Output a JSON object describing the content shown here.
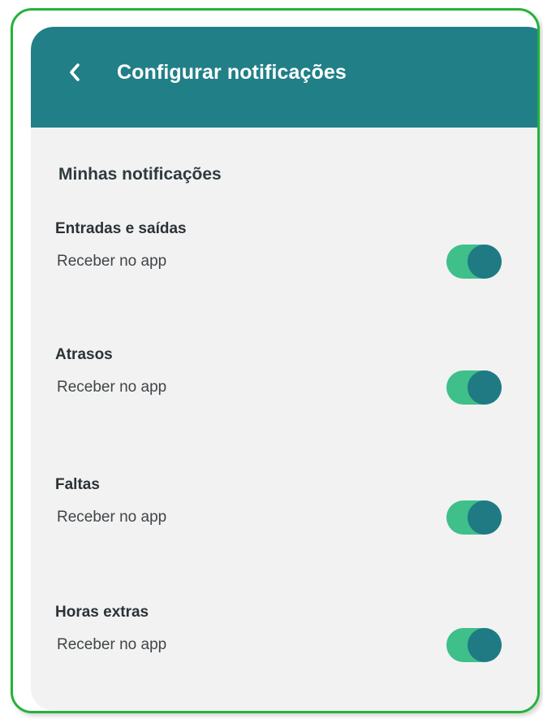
{
  "header": {
    "back_icon": "chevron-left-icon",
    "title": "Configurar notificações"
  },
  "section": {
    "title": "Minhas notificações"
  },
  "settings": [
    {
      "title": "Entradas e saídas",
      "subtitle": "Receber no app",
      "enabled": true
    },
    {
      "title": "Atrasos",
      "subtitle": "Receber no app",
      "enabled": true
    },
    {
      "title": "Faltas",
      "subtitle": "Receber no app",
      "enabled": true
    },
    {
      "title": "Horas extras",
      "subtitle": "Receber no app",
      "enabled": true
    }
  ],
  "colors": {
    "frame_border": "#22b33a",
    "header_bg": "#217f87",
    "screen_bg": "#f2f2f2",
    "toggle_track_on": "#3fbf8a",
    "toggle_knob_on": "#1f7a84"
  }
}
